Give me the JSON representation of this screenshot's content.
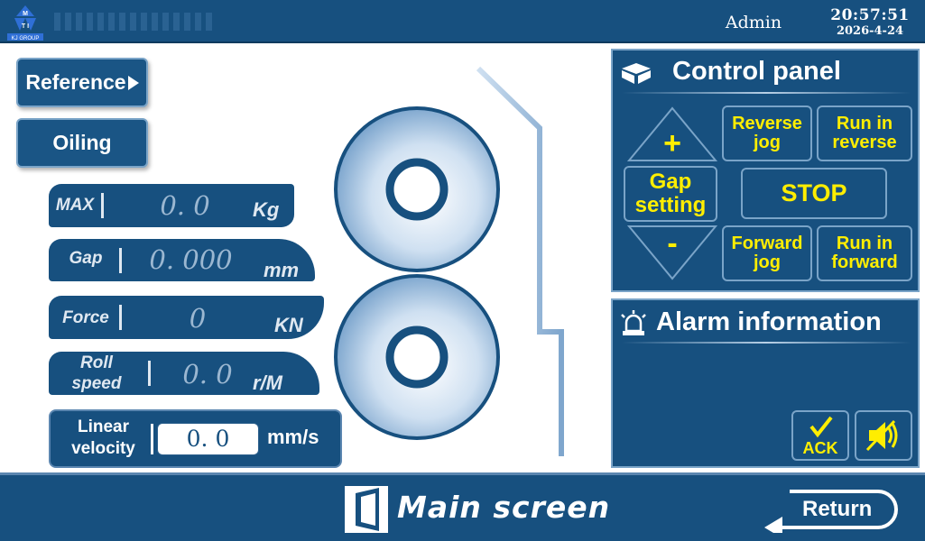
{
  "header": {
    "logo_text_top": "M",
    "logo_text_mid": "T I",
    "logo_caption": "KJ GROUP",
    "user": "Admin",
    "time": "20:57:51",
    "date": "2026-4-24",
    "background_color": "#17507f"
  },
  "left": {
    "reference_label": "Reference",
    "oiling_label": "Oiling",
    "fields": {
      "max": {
        "label": "MAX",
        "value": "0. 0",
        "unit": "Kg"
      },
      "gap": {
        "label": "Gap",
        "value": "0. 000",
        "unit": "mm"
      },
      "force": {
        "label": "Force",
        "value": "0",
        "unit": "KN"
      },
      "roll_speed": {
        "label_line1": "Roll",
        "label_line2": "speed",
        "value": "0. 0",
        "unit": "r/M"
      }
    },
    "linear_velocity": {
      "label_line1": "Linear",
      "label_line2": "velocity",
      "value": "0. 0",
      "unit": "mm/s"
    }
  },
  "control_panel": {
    "title": "Control panel",
    "icon": "cube-icon",
    "plus_label": "+",
    "minus_label": "-",
    "gap_setting_line1": "Gap",
    "gap_setting_line2": "setting",
    "reverse_jog_line1": "Reverse",
    "reverse_jog_line2": "jog",
    "run_reverse_line1": "Run in",
    "run_reverse_line2": "reverse",
    "stop_label": "STOP",
    "forward_jog_line1": "Forward",
    "forward_jog_line2": "jog",
    "run_forward_line1": "Run in",
    "run_forward_line2": "forward",
    "button_text_color": "#ffee00"
  },
  "alarm": {
    "title": "Alarm information",
    "icon": "alarm-light-icon",
    "ack_label": "ACK",
    "mute_icon": "mute-speaker-icon"
  },
  "footer": {
    "screen_title": "Main screen",
    "screen_icon": "door-icon",
    "return_label": "Return"
  }
}
